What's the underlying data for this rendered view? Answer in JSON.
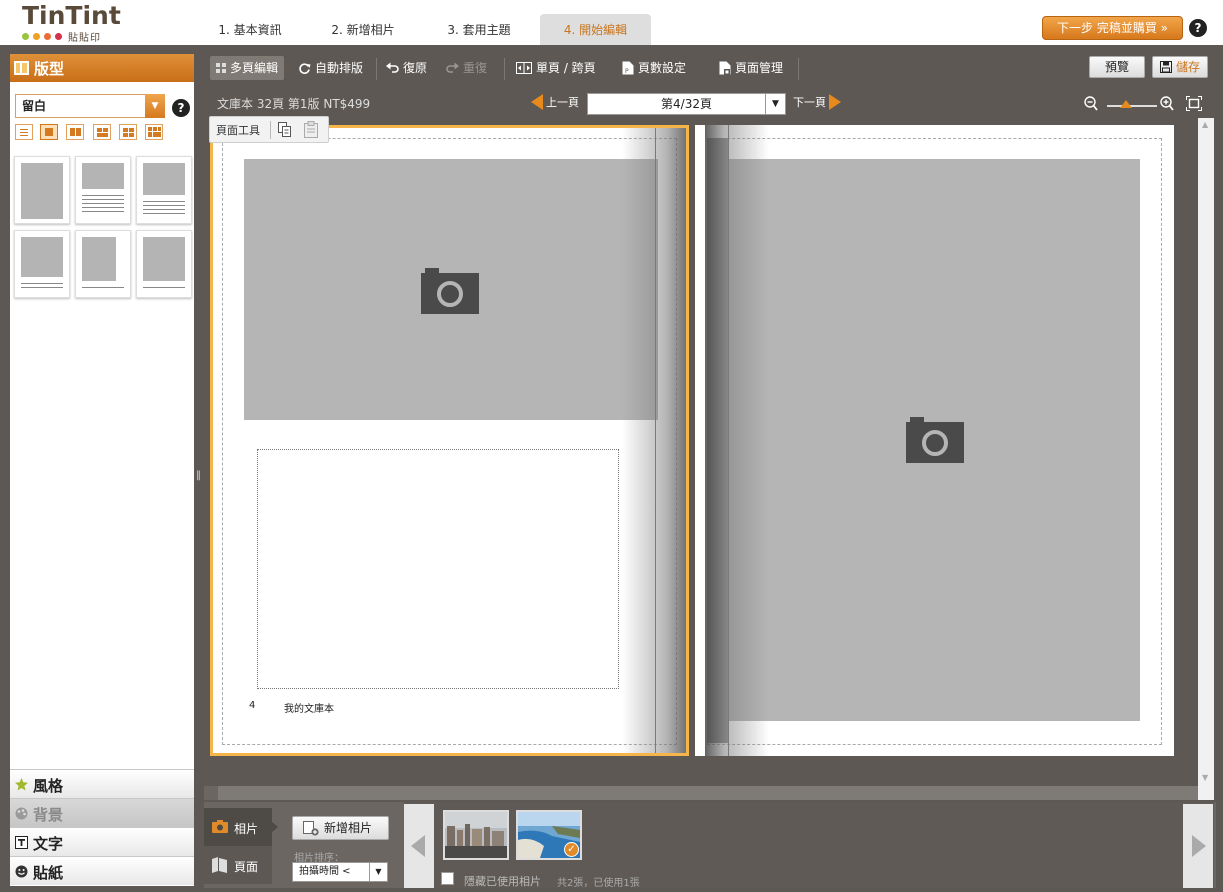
{
  "header": {
    "logo_text": "TinTint",
    "logo_sub": "貼貼印",
    "steps": [
      "1. 基本資訊",
      "2. 新增相片",
      "3. 套用主題",
      "4. 開始編輯"
    ],
    "next_button": "下一步 完稿並購買 »",
    "help": "?"
  },
  "left_panel": {
    "title": "版型",
    "layout_value": "留白",
    "help": "?",
    "tabs": [
      "風格",
      "背景",
      "文字",
      "貼紙"
    ]
  },
  "toolbar": {
    "multi_page": "多頁編輯",
    "auto_layout": "自動排版",
    "undo": "復原",
    "redo": "重復",
    "single_spread": "單頁 / 跨頁",
    "page_count": "頁數設定",
    "page_manage": "頁面管理",
    "preview": "預覽",
    "save": "儲存"
  },
  "infobar": {
    "book_info": "文庫本 32頁 第1版 NT$499",
    "prev": "上一頁",
    "page": "第4/32頁",
    "next": "下一頁"
  },
  "page_tools": {
    "label": "頁面工具"
  },
  "page_left": {
    "number": "4",
    "book_title": "我的文庫本"
  },
  "tray": {
    "tab_photo": "相片",
    "tab_page": "頁面",
    "add_photo": "新增相片",
    "sort_label": "相片排序：",
    "sort_value": "拍攝時間 <",
    "hide_used": "隱藏已使用相片",
    "count": "共2張，已使用1張"
  },
  "colors": {
    "accent": "#e08a2a",
    "frame": "#5d5854",
    "placeholder": "#b5b5b5"
  }
}
